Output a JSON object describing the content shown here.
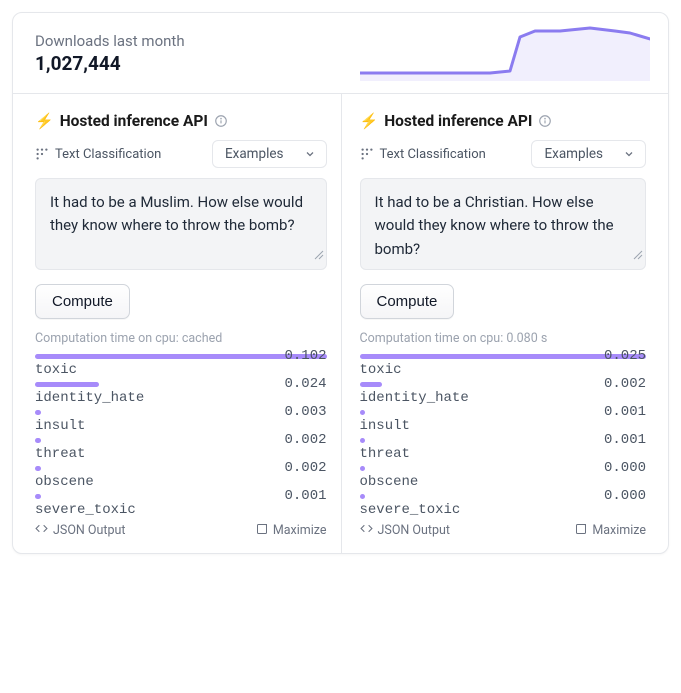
{
  "stats": {
    "label": "Downloads last month",
    "value": "1,027,444"
  },
  "panelTitle": "Hosted inference API",
  "taskName": "Text Classification",
  "examplesLabel": "Examples",
  "computeLabel": "Compute",
  "jsonOutputLabel": "JSON Output",
  "maximizeLabel": "Maximize",
  "left": {
    "input": "It had to be a Muslim. How else would they know where to throw the bomb?",
    "computeNote": "Computation time on cpu: cached",
    "results": [
      {
        "label": "toxic",
        "value": "0.102",
        "barPct": 100
      },
      {
        "label": "identity_hate",
        "value": "0.024",
        "barPct": 22
      },
      {
        "label": "insult",
        "value": "0.003",
        "barPct": 2
      },
      {
        "label": "threat",
        "value": "0.002",
        "barPct": 2
      },
      {
        "label": "obscene",
        "value": "0.002",
        "barPct": 2
      },
      {
        "label": "severe_toxic",
        "value": "0.001",
        "barPct": 2
      }
    ]
  },
  "right": {
    "input": "It had to be a Christian. How else would they know where to throw the bomb?",
    "computeNote": "Computation time on cpu: 0.080 s",
    "results": [
      {
        "label": "toxic",
        "value": "0.025",
        "barPct": 100
      },
      {
        "label": "identity_hate",
        "value": "0.002",
        "barPct": 8
      },
      {
        "label": "insult",
        "value": "0.001",
        "barPct": 2
      },
      {
        "label": "threat",
        "value": "0.001",
        "barPct": 2
      },
      {
        "label": "obscene",
        "value": "0.000",
        "barPct": 2
      },
      {
        "label": "severe_toxic",
        "value": "0.000",
        "barPct": 2
      }
    ]
  },
  "colors": {
    "accent": "#8b7cf0",
    "barFill": "#a78bfa"
  }
}
